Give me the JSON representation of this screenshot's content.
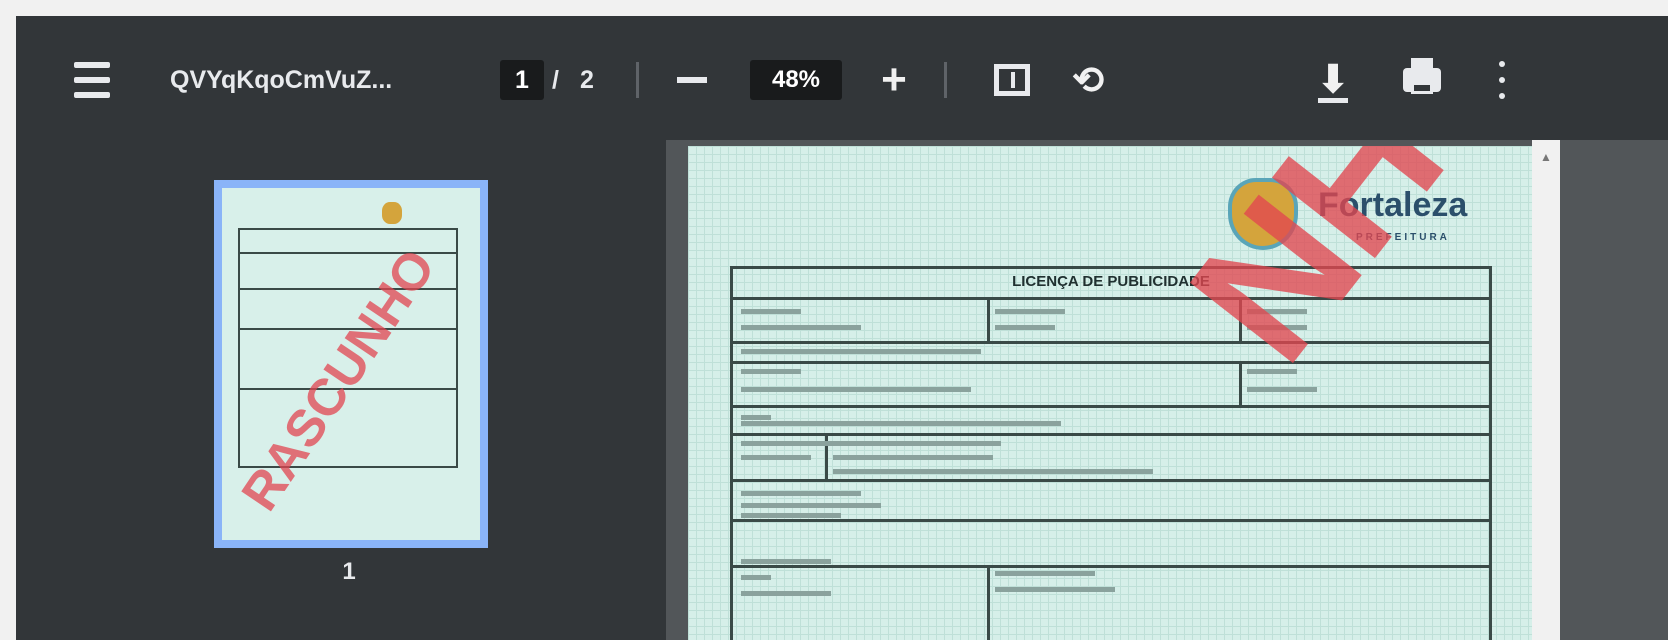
{
  "toolbar": {
    "doc_title": "QVYqKqoCmVuZ...",
    "current_page": "1",
    "page_sep": "/",
    "total_pages": "2",
    "zoom_out": "−",
    "zoom_level": "48%",
    "zoom_in": "+",
    "icons": [
      "menu-icon",
      "fit-page-icon",
      "rotate-icon",
      "download-icon",
      "print-icon",
      "more-icon"
    ]
  },
  "sidebar": {
    "thumbnails": [
      {
        "page": "1"
      }
    ]
  },
  "document": {
    "brand": "Fortaleza",
    "brand_sub": "PREFEITURA",
    "form_title": "LICENÇA DE PUBLICIDADE",
    "stamp": "RASCUNHO",
    "stamp_visible": "NHO"
  },
  "colors": {
    "toolbar_bg": "#323639",
    "viewer_bg": "#525659",
    "page_bg": "#d6efe9",
    "thumb_highlight": "#8ab4f8",
    "stamp": "#e24650"
  }
}
